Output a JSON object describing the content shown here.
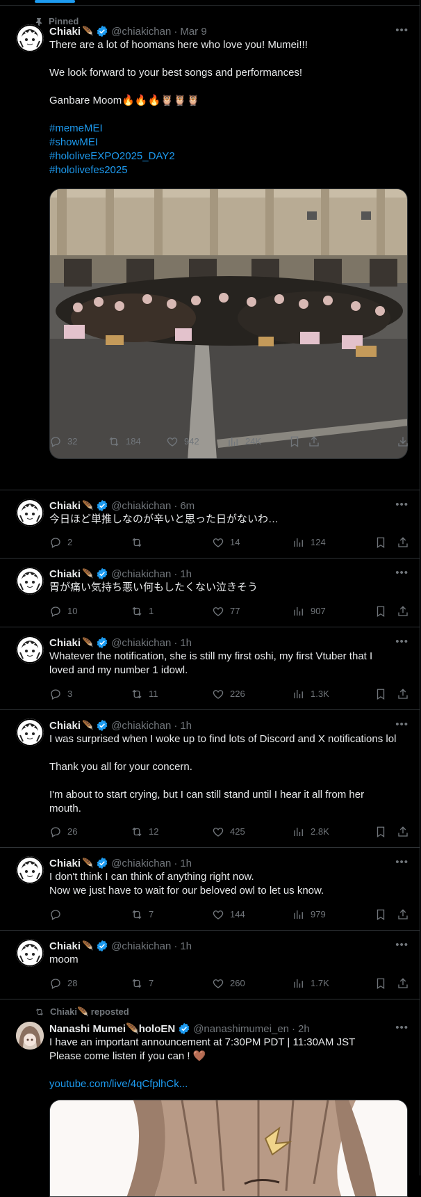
{
  "pinned_label": "Pinned",
  "user": {
    "name": "Chiaki",
    "feather": "🪶",
    "handle": "@chiakichan"
  },
  "colors": {
    "background": "#000000",
    "text": "#e7e9ea",
    "muted": "#71767b",
    "link": "#1d9bf0",
    "divider": "#2f3336",
    "verified": "#1d9bf0"
  },
  "tweets": [
    {
      "time": "Mar 9",
      "lines": [
        "There are a lot of hoomans here who love you! Mumei!!!",
        "",
        "We look forward to your best songs and performances!",
        "",
        "Ganbare Moom🔥🔥🔥🦉🦉🦉",
        ""
      ],
      "hashtags": [
        "#memeMEI",
        "#showMEI",
        "#hololiveEXPO2025_DAY2",
        "#hololivefes2025"
      ],
      "stats": {
        "replies": "32",
        "reposts": "184",
        "likes": "942",
        "views": "24K"
      }
    },
    {
      "time": "6m",
      "lines": [
        "今日ほど単推しなのが辛いと思った日がないわ…"
      ],
      "stats": {
        "replies": "2",
        "reposts": "",
        "likes": "14",
        "views": "124"
      }
    },
    {
      "time": "1h",
      "lines": [
        "胃が痛い気持ち悪い何もしたくない泣きそう"
      ],
      "stats": {
        "replies": "10",
        "reposts": "1",
        "likes": "77",
        "views": "907"
      }
    },
    {
      "time": "1h",
      "lines": [
        "Whatever the notification, she is still my first oshi, my first Vtuber that I",
        "loved and my number 1 idowl."
      ],
      "stats": {
        "replies": "3",
        "reposts": "11",
        "likes": "226",
        "views": "1.3K"
      }
    },
    {
      "time": "1h",
      "lines": [
        "I was surprised when I woke up to find lots of Discord and X notifications lol",
        "",
        "Thank you all for your concern.",
        "",
        "I'm about to start crying, but I can still stand until I hear it all from her",
        "mouth."
      ],
      "stats": {
        "replies": "26",
        "reposts": "12",
        "likes": "425",
        "views": "2.8K"
      }
    },
    {
      "time": "1h",
      "lines": [
        "I don't think I can think of anything right now.",
        "Now we just have to wait for our beloved owl to let us know."
      ],
      "stats": {
        "replies": "",
        "reposts": "7",
        "likes": "144",
        "views": "979"
      }
    },
    {
      "time": "1h",
      "lines": [
        "moom"
      ],
      "stats": {
        "replies": "28",
        "reposts": "7",
        "likes": "260",
        "views": "1.7K"
      }
    }
  ],
  "repost": {
    "label": "Chiaki🪶 reposted",
    "name": "Nanashi Mumei🪶holoEN",
    "handle": "@nanashimumei_en",
    "time": "2h",
    "lines": [
      "I have an important announcement at 7:30PM PDT | 11:30AM JST",
      "Please come listen if you can ! 🤎"
    ],
    "link": "youtube.com/live/4qCfplhCk..."
  }
}
